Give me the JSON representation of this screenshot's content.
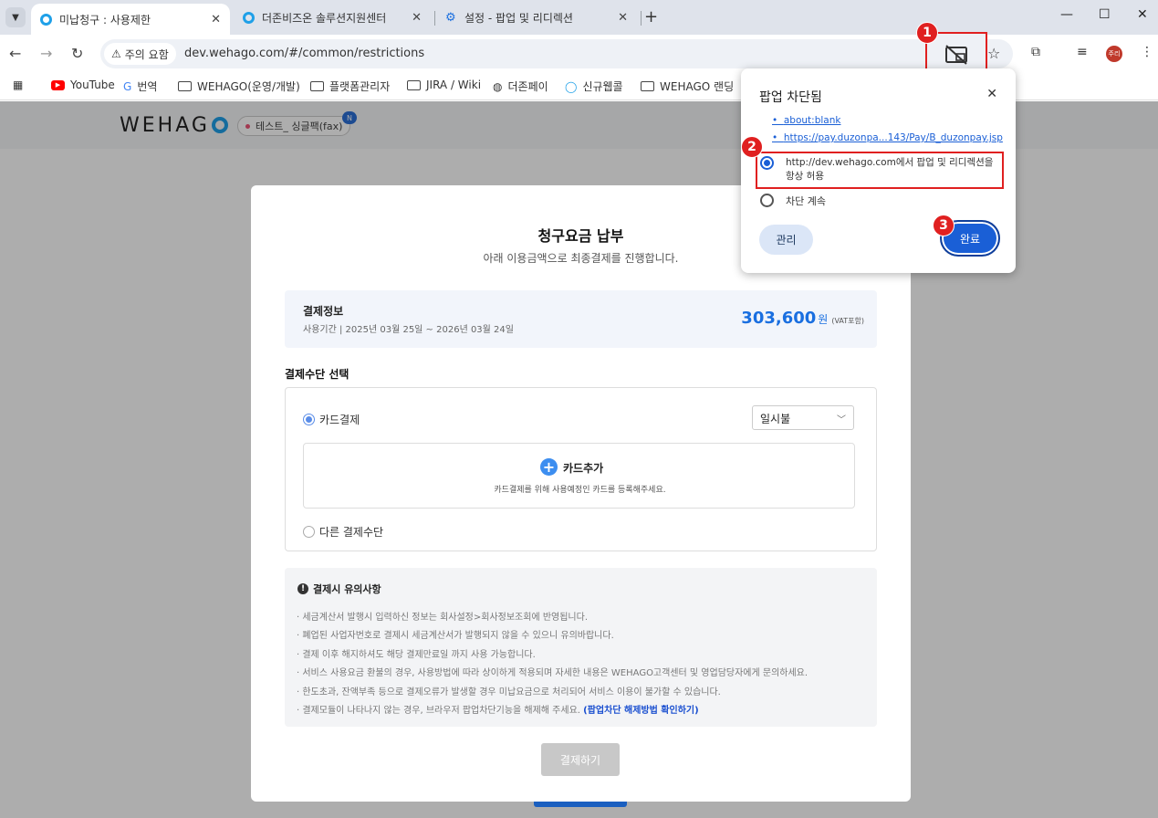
{
  "tabs": [
    {
      "title": "미납청구 : 사용제한",
      "active": true
    },
    {
      "title": "더존비즈온 솔루션지원센터",
      "active": false
    },
    {
      "title": "설정 - 팝업 및 리디렉션",
      "active": false
    }
  ],
  "toolbar": {
    "security_chip": "주의 요함",
    "url": "dev.wehago.com/#/common/restrictions",
    "profile": "주리"
  },
  "bookmarks": [
    {
      "label": "YouTube",
      "icon": "youtube-icon"
    },
    {
      "label": "번역",
      "icon": "translate-icon"
    },
    {
      "label": "WEHAGO(운영/개발)",
      "icon": "folder-icon"
    },
    {
      "label": "플랫폼관리자",
      "icon": "folder-icon"
    },
    {
      "label": "JIRA / Wiki",
      "icon": "folder-icon"
    },
    {
      "label": "더존페이",
      "icon": "globe-icon"
    },
    {
      "label": "신규웹콜",
      "icon": "ring-icon"
    },
    {
      "label": "WEHAGO 랜딩",
      "icon": "folder-icon"
    }
  ],
  "header": {
    "logo": "WEHAG",
    "company": "테스트_ 싱글팩(fax)",
    "badge": "N"
  },
  "modal": {
    "title": "청구요금 납부",
    "subtitle": "아래 이용금액으로 최종결제를 진행합니다.",
    "payment_info": {
      "label": "결제정보",
      "period": "사용기간 | 2025년 03월 25일 ~ 2026년 03월 24일",
      "amount": "303,600",
      "currency": "원",
      "vat": "(VAT포함)"
    },
    "method_label": "결제수단 선택",
    "card_option": "카드결제",
    "installment": "일시불",
    "add_card_label": "카드추가",
    "add_card_desc": "카드결제를 위해 사용예정인 카드를 등록해주세요.",
    "other_option": "다른 결제수단",
    "notice_title": "결제시 유의사항",
    "notices": [
      "· 세금계산서 발행시 입력하신 정보는 회사설정>회사정보조회에 반영됩니다.",
      "· 폐업된 사업자번호로 결제시 세금계산서가 발행되지 않을 수 있으니 유의바랍니다.",
      "· 결제 이후 해지하셔도 해당 결제만료일 까지 사용 가능합니다.",
      "· 서비스 사용요금 환불의 경우, 사용방법에 따라 상이하게 적용되며 자세한 내용은 WEHAGO고객센터 및 영업담당자에게 문의하세요.",
      "· 한도초과, 잔액부족 등으로 결제오류가 발생할 경우 미납요금으로 처리되어 서비스 이용이 불가할 수 있습니다."
    ],
    "notice_last": "· 결제모듈이 나타나지 않는 경우, 브라우저 팝업차단기능을 해제해 주세요.",
    "notice_link": "(팝업차단 해제방법 확인하기)",
    "pay_button": "결제하기"
  },
  "popup_bubble": {
    "title": "팝업 차단됨",
    "links": [
      "about:blank",
      "https://pay.duzonpa...143/Pay/B_duzonpay.jsp"
    ],
    "allow_option": "http://dev.wehago.com에서 팝업 및 리디렉션을 항상 허용",
    "block_option": "차단 계속",
    "manage_button": "관리",
    "done_button": "완료"
  },
  "steps": [
    "1",
    "2",
    "3"
  ],
  "colors": {
    "accent": "#1a5fd6",
    "highlight": "#e02020",
    "amount": "#1a6fe0"
  }
}
